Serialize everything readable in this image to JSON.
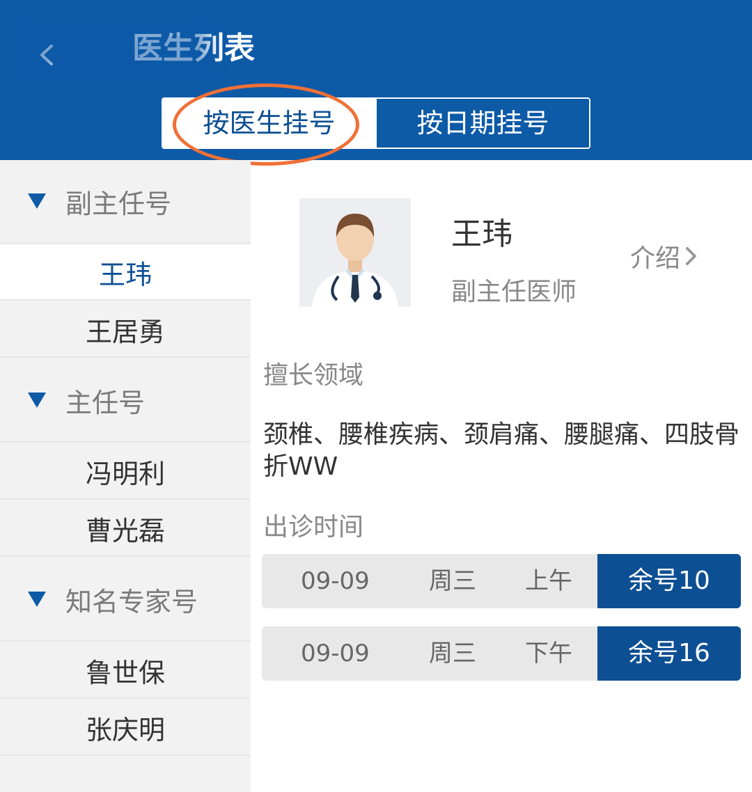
{
  "header": {
    "title": "医生列表",
    "back_icon": "chevron-left-icon",
    "background_color": "#0d5aa7"
  },
  "tabs": [
    {
      "label": "按医生挂号",
      "active": true
    },
    {
      "label": "按日期挂号",
      "active": false
    }
  ],
  "annotation_color": "#f07036",
  "sidebar": {
    "groups": [
      {
        "label": "副主任号",
        "doctors": [
          "王玮",
          "王居勇"
        ]
      },
      {
        "label": "主任号",
        "doctors": [
          "冯明利",
          "曹光磊"
        ]
      },
      {
        "label": "知名专家号",
        "doctors": [
          "鲁世保",
          "张庆明"
        ]
      }
    ],
    "selected_doctor": "王玮"
  },
  "doctor": {
    "name": "王玮",
    "title": "副主任医师",
    "intro_label": "介绍",
    "avatar_icon": "doctor-avatar-icon",
    "specialty_label": "擅长领域",
    "specialty_text": "颈椎、腰椎疾病、颈肩痛、腰腿痛、四肢骨折WW",
    "schedule_label": "出诊时间"
  },
  "schedule": [
    {
      "date": "09-09",
      "weekday": "周三",
      "period": "上午",
      "remaining": "余号10"
    },
    {
      "date": "09-09",
      "weekday": "周三",
      "period": "下午",
      "remaining": "余号16"
    }
  ],
  "colors": {
    "primary": "#0d4f93",
    "sidebar_bg": "#f2f2f2"
  }
}
